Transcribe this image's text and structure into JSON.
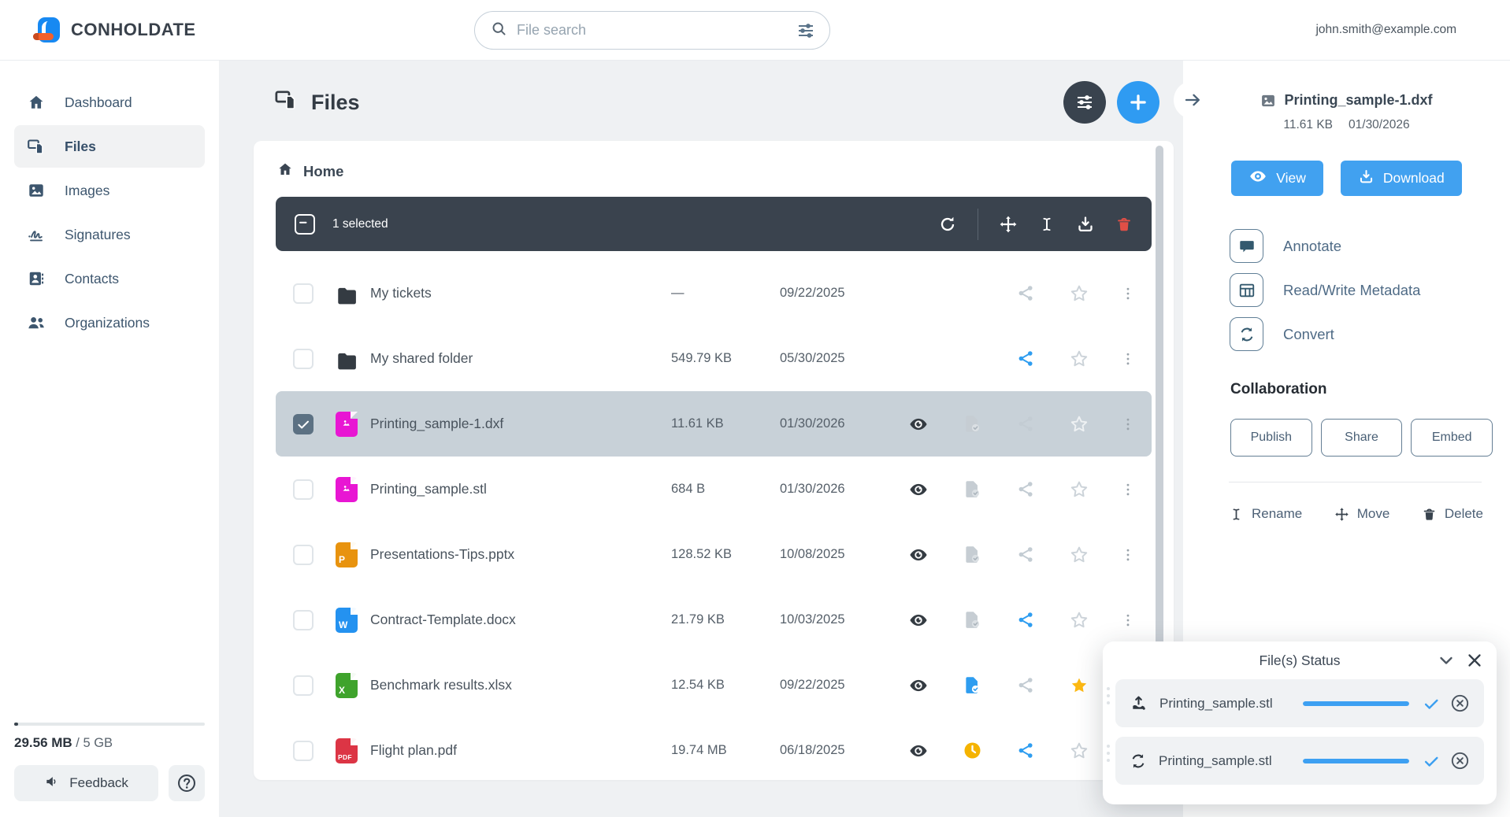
{
  "topbar": {
    "brand": "CONHOLDATE",
    "search_placeholder": "File search",
    "user_email": "john.smith@example.com"
  },
  "sidebar": {
    "items": [
      {
        "id": "dashboard",
        "label": "Dashboard",
        "icon": "home",
        "active": false
      },
      {
        "id": "files",
        "label": "Files",
        "icon": "files",
        "active": true
      },
      {
        "id": "images",
        "label": "Images",
        "icon": "image",
        "active": false
      },
      {
        "id": "signatures",
        "label": "Signatures",
        "icon": "signature",
        "active": false
      },
      {
        "id": "contacts",
        "label": "Contacts",
        "icon": "contact",
        "active": false
      },
      {
        "id": "organizations",
        "label": "Organizations",
        "icon": "users",
        "active": false
      }
    ],
    "storage_used": "29.56 MB",
    "storage_total": " / 5 GB",
    "storage_percent": 2,
    "feedback_label": "Feedback"
  },
  "main": {
    "title": "Files",
    "breadcrumb": "Home",
    "toolbar": {
      "selected_text": "1 selected"
    },
    "rows": [
      {
        "name": "My tickets",
        "size": "—",
        "date": "09/22/2025",
        "icon": {
          "kind": "folder"
        },
        "eye": false,
        "badge": null,
        "share": "gray",
        "star": "outline",
        "selected": false
      },
      {
        "name": "My shared folder",
        "size": "549.79 KB",
        "date": "05/30/2025",
        "icon": {
          "kind": "folder"
        },
        "eye": false,
        "badge": null,
        "share": "blue",
        "star": "outline",
        "selected": false
      },
      {
        "name": "Printing_sample-1.dxf",
        "size": "11.61 KB",
        "date": "01/30/2026",
        "icon": {
          "kind": "image",
          "color": "#e816d3"
        },
        "eye": true,
        "badge": "check-gray",
        "share": "gray",
        "star": "outline",
        "selected": true
      },
      {
        "name": "Printing_sample.stl",
        "size": "684 B",
        "date": "01/30/2026",
        "icon": {
          "kind": "image",
          "color": "#e816d3"
        },
        "eye": true,
        "badge": "check-gray",
        "share": "gray",
        "star": "outline",
        "selected": false
      },
      {
        "name": "Presentations-Tips.pptx",
        "size": "128.52 KB",
        "date": "10/08/2025",
        "icon": {
          "kind": "letter",
          "color": "#e8930f",
          "letter": "P"
        },
        "eye": true,
        "badge": "check-gray",
        "share": "gray",
        "star": "outline",
        "selected": false
      },
      {
        "name": "Contract-Template.docx",
        "size": "21.79 KB",
        "date": "10/03/2025",
        "icon": {
          "kind": "letter",
          "color": "#2492f0",
          "letter": "W"
        },
        "eye": true,
        "badge": "check-gray",
        "share": "blue",
        "star": "outline",
        "selected": false
      },
      {
        "name": "Benchmark results.xlsx",
        "size": "12.54 KB",
        "date": "09/22/2025",
        "icon": {
          "kind": "letter",
          "color": "#3fa32c",
          "letter": "X"
        },
        "eye": true,
        "badge": "check-blue",
        "share": "gray",
        "star": "filled",
        "selected": false
      },
      {
        "name": "Flight plan.pdf",
        "size": "19.74 MB",
        "date": "06/18/2025",
        "icon": {
          "kind": "pdf",
          "color": "#dc3545",
          "letter": "PDF"
        },
        "eye": true,
        "badge": "clock",
        "share": "blue",
        "star": "outline",
        "selected": false
      }
    ]
  },
  "panel": {
    "file_name": "Printing_sample-1.dxf",
    "file_size": "11.61 KB",
    "file_date": "01/30/2026",
    "view_label": "View",
    "download_label": "Download",
    "actions": [
      {
        "id": "annotate",
        "icon": "comment",
        "label": "Annotate"
      },
      {
        "id": "metadata",
        "icon": "table",
        "label": "Read/Write Metadata"
      },
      {
        "id": "convert",
        "icon": "convert",
        "label": "Convert"
      }
    ],
    "collaboration_title": "Collaboration",
    "collab_buttons": [
      {
        "id": "publish",
        "label": "Publish"
      },
      {
        "id": "share",
        "label": "Share"
      },
      {
        "id": "embed",
        "label": "Embed"
      }
    ],
    "footer_actions": [
      {
        "id": "rename",
        "icon": "ibeam",
        "label": "Rename"
      },
      {
        "id": "move",
        "icon": "move",
        "label": "Move"
      },
      {
        "id": "delete",
        "icon": "trash",
        "label": "Delete"
      }
    ]
  },
  "status_popup": {
    "title": "File(s) Status",
    "items": [
      {
        "icon": "upload",
        "name": "Printing_sample.stl",
        "progress": 100
      },
      {
        "icon": "convert",
        "name": "Printing_sample.stl",
        "progress": 100
      }
    ]
  },
  "colors": {
    "accent_blue": "#3f9ff0",
    "toolbar_dark": "#3a434e",
    "selected_row": "#c8d1d8",
    "star_yellow": "#fdb913",
    "clock_yellow": "#f5b300",
    "danger_red": "#e04f46",
    "gray_icon": "#c3ccd3"
  }
}
